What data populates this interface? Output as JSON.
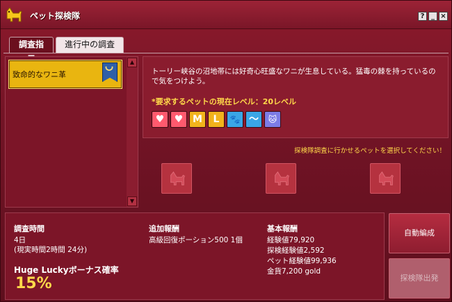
{
  "window": {
    "title": "ペット探検隊",
    "help_label": "?",
    "minimize_label": "_",
    "close_label": "×"
  },
  "tabs": [
    {
      "label": "調査指示"
    },
    {
      "label": "進行中の調査"
    }
  ],
  "mission_list": {
    "items": [
      {
        "label": "致命的なワニ革"
      }
    ]
  },
  "mission_detail": {
    "description": "トーリー峡谷の沼地帯には好奇心旺盛なワニが生息している。猛毒の棘を持っているので気をつけよう。",
    "required_level_text": "*要求するペットの現在レベル：20レベル",
    "pet_traits": [
      {
        "icon": "heart-icon",
        "glyph": "♥",
        "color": "#ff5a6e"
      },
      {
        "icon": "heart-icon",
        "glyph": "♥",
        "color": "#ff5a6e"
      },
      {
        "icon": "letter-m-icon",
        "glyph": "M",
        "color": "#f2b31c"
      },
      {
        "icon": "letter-l-icon",
        "glyph": "L",
        "color": "#f2b31c"
      },
      {
        "icon": "paw-icon",
        "glyph": "🐾",
        "color": "#3aa6e6"
      },
      {
        "icon": "wing-icon",
        "glyph": "〜",
        "color": "#3aa6e6"
      },
      {
        "icon": "cat-icon",
        "glyph": "🐱",
        "color": "#7c7ce6"
      }
    ]
  },
  "pet_select": {
    "hint": "探検隊調査に行かせるペットを選択してください！"
  },
  "duration": {
    "heading": "調査時間",
    "value": "4日",
    "real_time": "(現実時間2時間 24分)"
  },
  "bonus": {
    "label": "Huge Luckyボーナス確率",
    "percent": "15%"
  },
  "extra_reward": {
    "heading": "追加報酬",
    "item": "高級回復ポーション500 1個"
  },
  "base_reward": {
    "heading": "基本報酬",
    "items": [
      "経験値79,920",
      "探検経験値2,592",
      "ペット経験値99,936",
      "金貨7,200 gold"
    ]
  },
  "buttons": {
    "auto_label": "自動編成",
    "depart_label": "探検隊出発"
  },
  "colors": {
    "accent": "#ffd84a",
    "selected_item": "#e9b510",
    "background": "#731426"
  }
}
